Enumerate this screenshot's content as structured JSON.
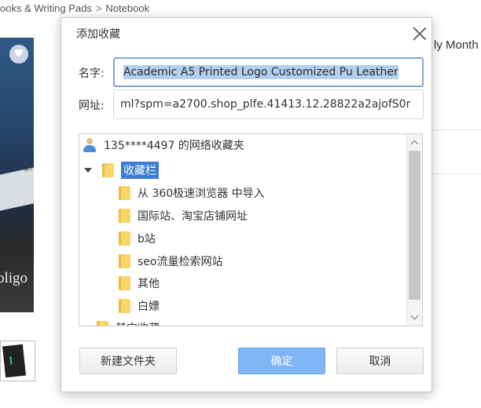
{
  "background": {
    "breadcrumb": {
      "part1": "ooks & Writing Pads",
      "separator": ">",
      "part2": "Notebook"
    },
    "right_text": "ly Month",
    "image_logo_text": "oligo",
    "image_small_text": "scri"
  },
  "dialog": {
    "title": "添加收藏",
    "name_label": "名字:",
    "name_value": "Academic A5 Printed Logo Customized Pu Leather",
    "url_label": "网址:",
    "url_value": "ml?spm=a2700.shop_plfe.41413.12.28822a2ajofS0r",
    "tree": {
      "account": "135****4497 的网络收藏夹",
      "root_folder": "收藏栏",
      "folders": [
        "从 360极速浏览器 中导入",
        "国际站、淘宝店铺网址",
        "b站",
        "seo流量检索网站",
        "其他",
        "白嫖"
      ],
      "partial_folder": "其它收藏"
    },
    "buttons": {
      "new_folder": "新建文件夹",
      "ok": "确定",
      "cancel": "取消"
    }
  },
  "colors": {
    "accent": "#3f7dd1",
    "ok_button": "#7fb5f4",
    "folder": "#f9d46b"
  }
}
